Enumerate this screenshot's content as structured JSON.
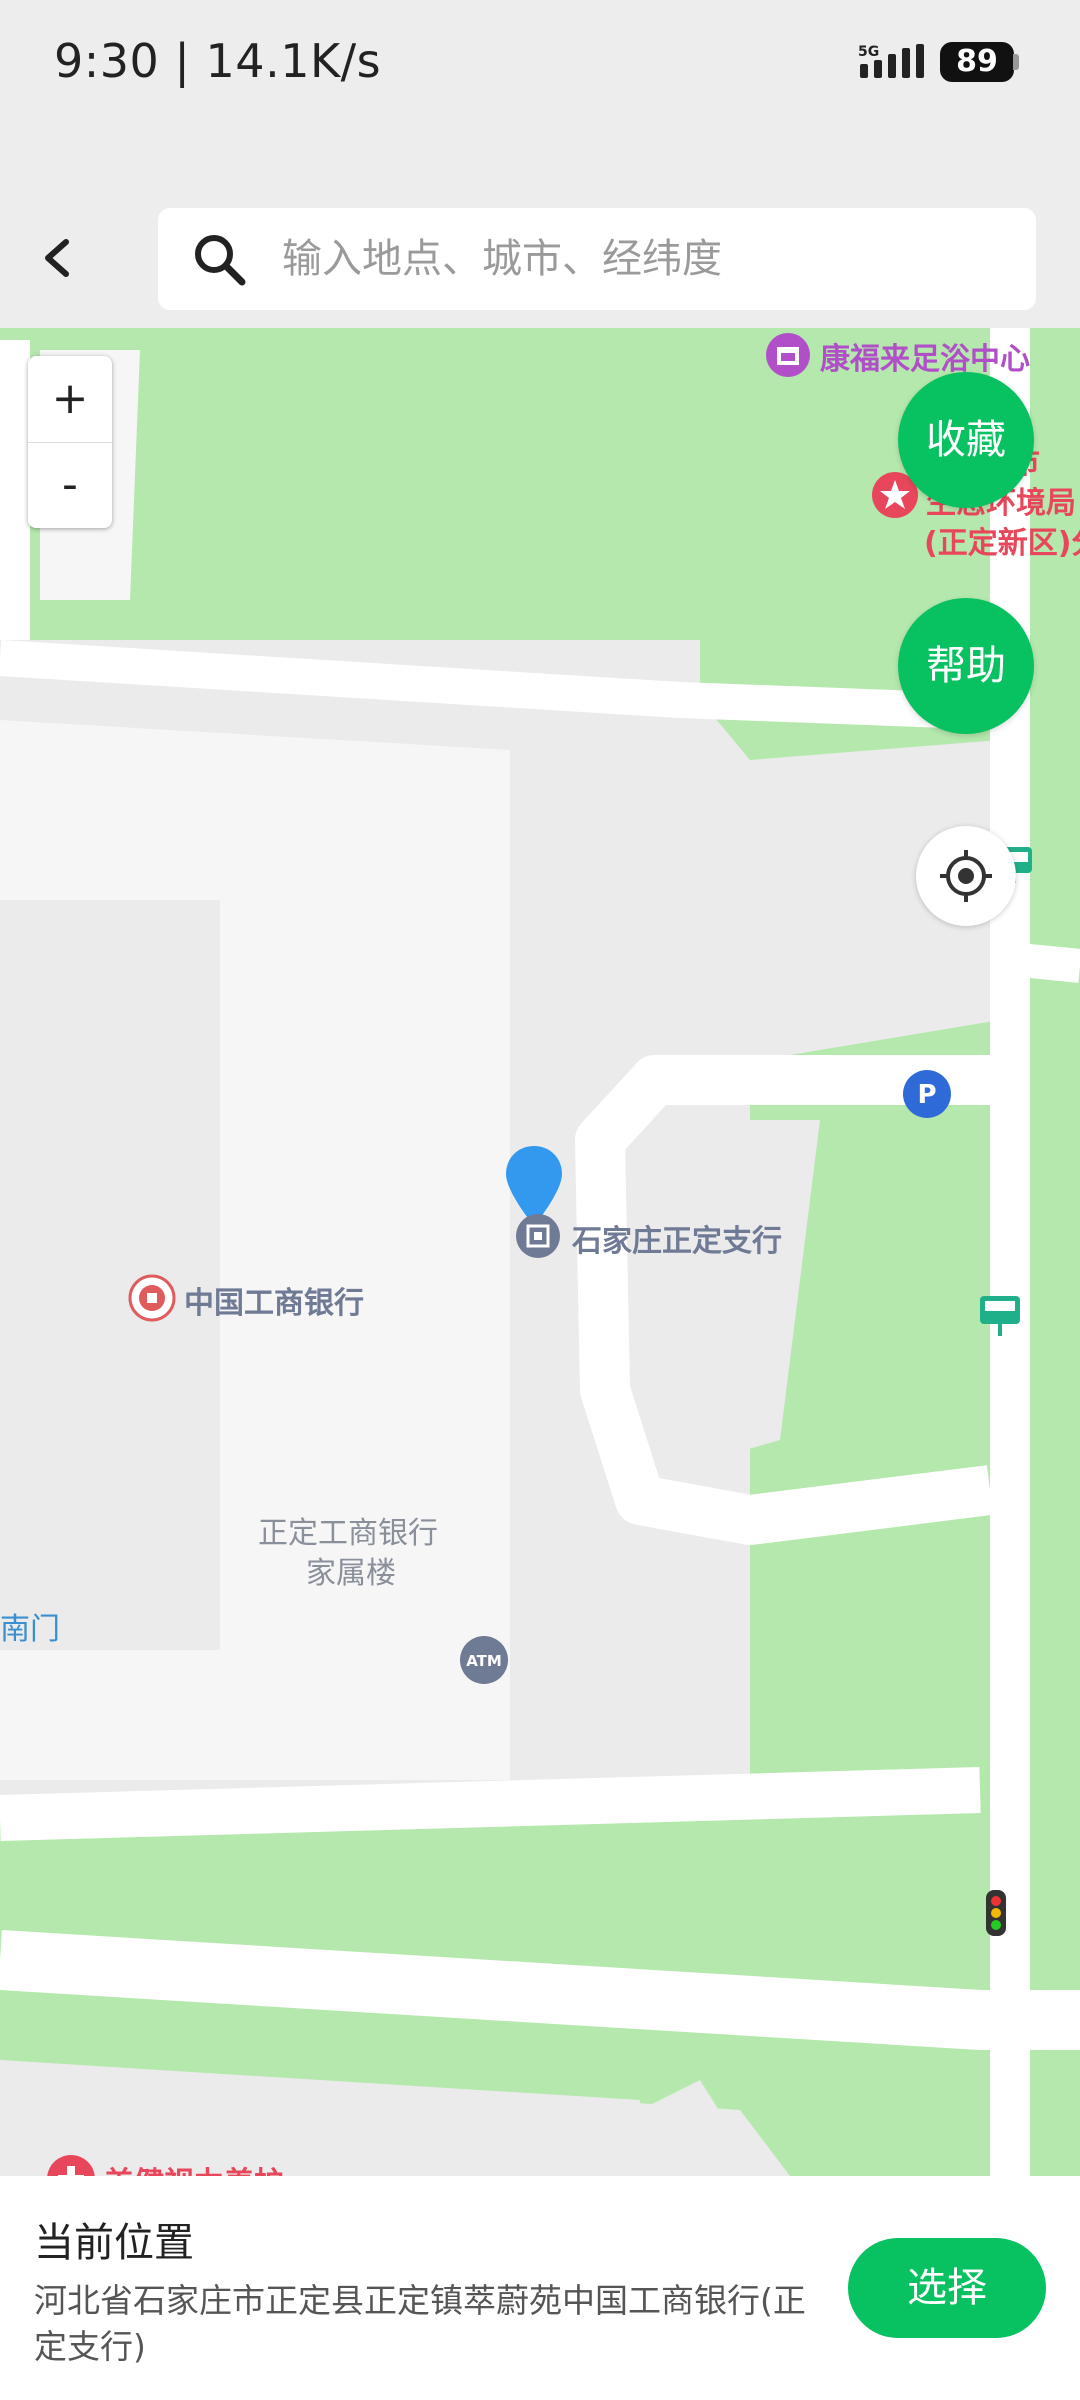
{
  "status_bar": {
    "time": "9:30 | 14.1K/s",
    "network": "5G",
    "battery": "89"
  },
  "header": {
    "back_icon": "chevron-left-icon",
    "search_icon": "search-icon",
    "search_placeholder": "输入地点、城市、经纬度"
  },
  "map": {
    "zoom_in": "+",
    "zoom_out": "-",
    "buttons": {
      "favorite": "收藏",
      "help": "帮助"
    },
    "locate_icon": "locate-icon",
    "pois": [
      {
        "label": "康福来足浴中心",
        "color": "#b04fc8"
      },
      {
        "label": "市",
        "color": "#e8475b"
      },
      {
        "label": "生态环境局",
        "color": "#e8475b"
      },
      {
        "label": "(正定新区)分",
        "color": "#e8475b"
      },
      {
        "label": "石家庄正定支行",
        "color": "#6f7a94"
      },
      {
        "label": "中国工商银行",
        "color": "#6f7a94"
      },
      {
        "label": "正定工商银行",
        "color": "#8a8f9c"
      },
      {
        "label": "家属楼",
        "color": "#8a8f9c"
      },
      {
        "label": "南门",
        "color": "#3a8fd1"
      },
      {
        "label": "美健视力养护",
        "color": "#e8475b"
      },
      {
        "label": "ATM",
        "color": "#ffffff"
      },
      {
        "label": "P",
        "color": "#ffffff"
      }
    ],
    "colors": {
      "green": "#b5e8ad",
      "road": "#ffffff",
      "block": "#f6f6f6",
      "ground": "#ebebeb",
      "marker": "#3399ee"
    }
  },
  "panel": {
    "title": "当前位置",
    "address": "河北省石家庄市正定县正定镇萃蔚苑中国工商银行(正定支行)",
    "select_button": "选择"
  }
}
